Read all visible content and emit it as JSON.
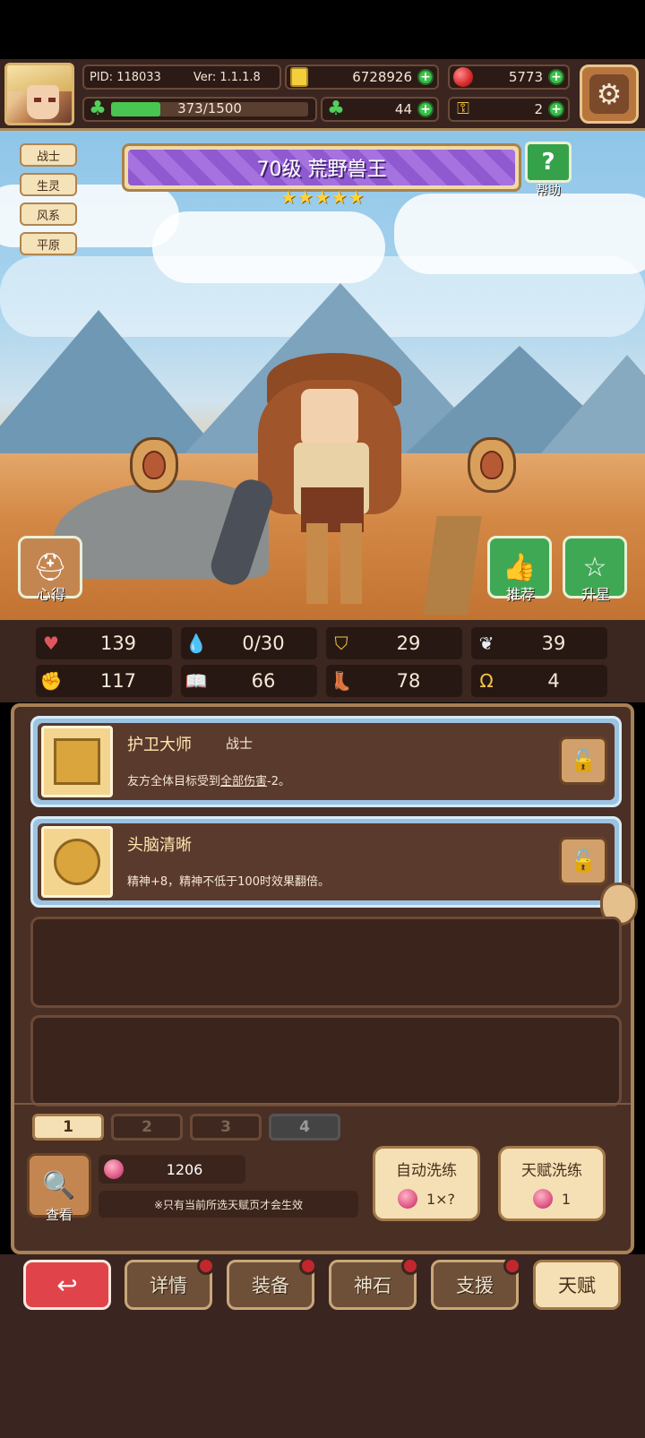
{
  "header": {
    "pid": "PID: 118033",
    "version": "Ver: 1.1.1.8",
    "gold": "6728926",
    "gems": "5773",
    "energy": "373/1500",
    "energy_fraction": 0.249,
    "clover": "44",
    "keys": "2"
  },
  "hero": {
    "tags": [
      "战士",
      "生灵",
      "风系",
      "平原"
    ],
    "title": "70级 荒野兽王",
    "stars": "★★★★★",
    "star_count": 5,
    "help_label": "帮助",
    "left_button_label": "心得",
    "recommend_label": "推荐",
    "star_up_label": "升星"
  },
  "stats": [
    {
      "icon": "heart-icon",
      "value": "139"
    },
    {
      "icon": "mana-drop-icon",
      "value": "0/30"
    },
    {
      "icon": "shield-icon",
      "value": "29"
    },
    {
      "icon": "wing-icon",
      "value": "39"
    },
    {
      "icon": "fist-icon",
      "value": "117"
    },
    {
      "icon": "book-icon",
      "value": "66"
    },
    {
      "icon": "speed-icon",
      "value": "78"
    },
    {
      "icon": "horseshoe-icon",
      "value": "4"
    }
  ],
  "talents": [
    {
      "name": "护卫大师",
      "class": "战士",
      "desc_prefix": "友方全体目标受到",
      "desc_link": "全部伤害",
      "desc_suffix": "-2。"
    },
    {
      "name": "头脑清晰",
      "class": "",
      "desc_prefix": "精神+8，精神不低于100时效果翻倍。",
      "desc_link": "",
      "desc_suffix": ""
    }
  ],
  "pages": [
    "1",
    "2",
    "3",
    "4"
  ],
  "bottom": {
    "view_label": "查看",
    "fruit_count": "1206",
    "note": "※只有当前所选天赋页才会生效",
    "auto_refine": {
      "label": "自动洗练",
      "cost": "1×?"
    },
    "talent_refine": {
      "label": "天赋洗练",
      "cost": "1"
    }
  },
  "nav": {
    "details": "详情",
    "equip": "装备",
    "stone": "神石",
    "support": "支援",
    "talent": "天赋"
  },
  "colors": {
    "accent_purple": "#8f5ad0",
    "plus_green": "#3cbf48",
    "nav_active": "#f4e0b4",
    "back_red": "#e0444a"
  }
}
